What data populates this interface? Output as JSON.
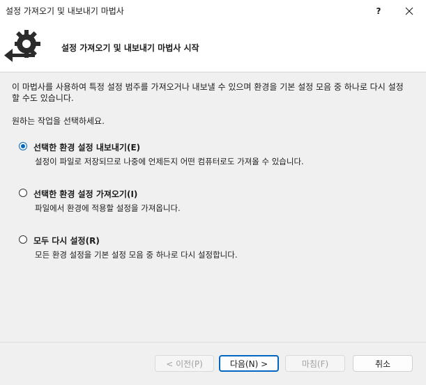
{
  "window": {
    "title": "설정 가져오기 및 내보내기 마법사",
    "help_label": "?",
    "close_icon": "close-icon"
  },
  "header": {
    "title": "설정 가져오기 및 내보내기 마법사 시작",
    "logo_icon": "gear-arrow-icon"
  },
  "main": {
    "intro": "이 마법사를 사용하여 특정 설정 범주를 가져오거나 내보낼 수 있으며 환경을 기본 설정 모음 중 하나로 다시 설정할 수도 있습니다.",
    "prompt": "원하는 작업을 선택하세요.",
    "options": [
      {
        "label": "선택한 환경 설정 내보내기(E)",
        "description": "설정이 파일로 저장되므로 나중에 언제든지 어떤 컴퓨터로도 가져올 수 있습니다.",
        "checked": true
      },
      {
        "label": "선택한 환경 설정 가져오기(I)",
        "description": "파일에서 환경에 적용할 설정을 가져옵니다.",
        "checked": false
      },
      {
        "label": "모두 다시 설정(R)",
        "description": "모든 환경 설정을 기본 설정 모음 중 하나로 다시 설정합니다.",
        "checked": false
      }
    ]
  },
  "buttons": {
    "back": "< 이전(P)",
    "next": "다음(N) >",
    "finish": "마침(F)",
    "cancel": "취소"
  },
  "colors": {
    "accent": "#0067c0",
    "body_background": "#f0f0f0",
    "logo": "#2b2b2b"
  }
}
